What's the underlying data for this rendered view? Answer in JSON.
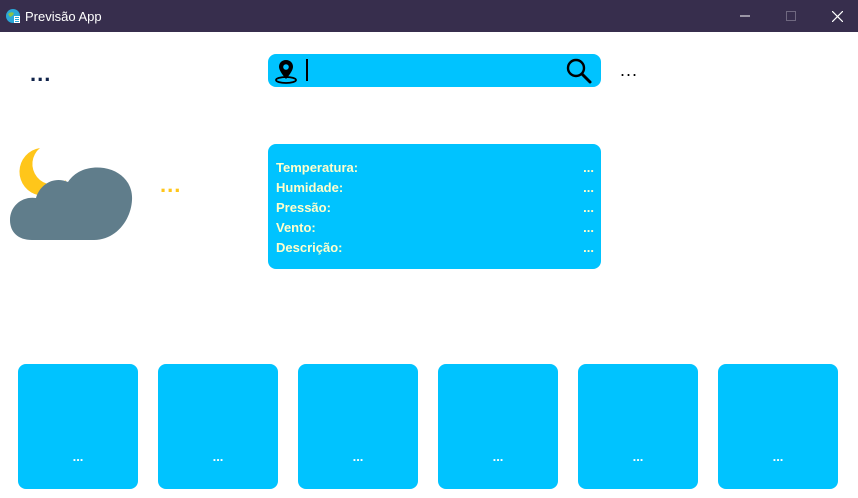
{
  "window": {
    "title": "Previsão App"
  },
  "header": {
    "city_label": "...",
    "time_label": "..."
  },
  "search": {
    "value": "",
    "placeholder": ""
  },
  "current": {
    "condition_label": "...",
    "icon": "moon-cloud-icon",
    "details": [
      {
        "key": "Temperatura:",
        "value": "..."
      },
      {
        "key": "Humidade:",
        "value": "..."
      },
      {
        "key": "Pressão:",
        "value": "..."
      },
      {
        "key": "Vento:",
        "value": "..."
      },
      {
        "key": "Descrição:",
        "value": "..."
      }
    ]
  },
  "forecast": [
    {
      "label": "..."
    },
    {
      "label": "..."
    },
    {
      "label": "..."
    },
    {
      "label": "..."
    },
    {
      "label": "..."
    },
    {
      "label": "..."
    }
  ],
  "colors": {
    "titlebar": "#372e4d",
    "accent": "#00c3ff",
    "condition_text": "#ffc61a",
    "cloud": "#607d8b",
    "moon": "#ffc61a"
  }
}
